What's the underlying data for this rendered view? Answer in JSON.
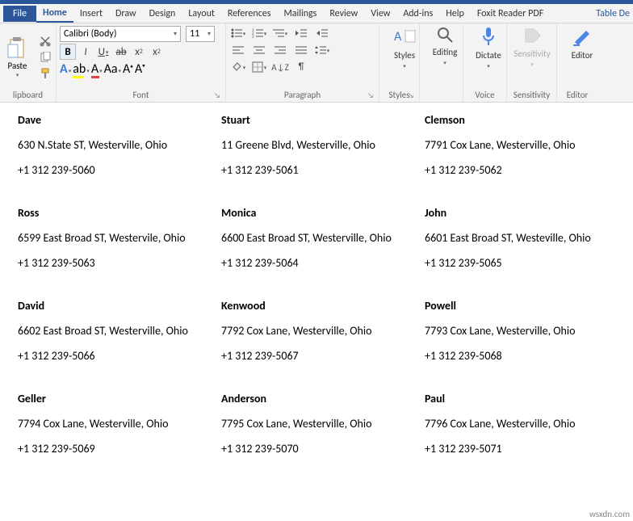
{
  "tabs": {
    "file": "File",
    "items": [
      "Home",
      "Insert",
      "Draw",
      "Design",
      "Layout",
      "References",
      "Mailings",
      "Review",
      "View",
      "Add-ins",
      "Help",
      "Foxit Reader PDF"
    ],
    "active": "Home",
    "table": "Table De"
  },
  "ribbon": {
    "clipboard": {
      "paste": "Paste",
      "label": "lipboard"
    },
    "font": {
      "name": "Calibri (Body)",
      "size": "11",
      "label": "Font"
    },
    "paragraph": {
      "label": "Paragraph"
    },
    "styles": {
      "btn": "Styles",
      "label": "Styles"
    },
    "editing": {
      "btn": "Editing"
    },
    "dictate": {
      "btn": "Dictate",
      "label": "Voice"
    },
    "sensitivity": {
      "btn": "Sensitivity",
      "label": "Sensitivity"
    },
    "editor": {
      "btn": "Editor",
      "label": "Editor"
    }
  },
  "labels": [
    {
      "name": "Dave",
      "addr": "630 N.State ST, Westerville, Ohio",
      "phone": "+1 312 239-5060"
    },
    {
      "name": "Stuart",
      "addr": "11 Greene Blvd, Westerville, Ohio",
      "phone": "+1 312 239-5061"
    },
    {
      "name": "Clemson",
      "addr": "7791 Cox Lane, Westerville, Ohio",
      "phone": "+1 312 239-5062"
    },
    {
      "name": "Ross",
      "addr": "6599 East Broad ST, Westervile, Ohio",
      "phone": "+1 312 239-5063"
    },
    {
      "name": "Monica",
      "addr": "6600 East Broad ST, Westerville, Ohio",
      "phone": "+1 312 239-5064"
    },
    {
      "name": "John",
      "addr": "6601 East Broad ST, Westeville, Ohio",
      "phone": "+1 312 239-5065"
    },
    {
      "name": "David",
      "addr": "6602 East Broad ST, Westerville, Ohio",
      "phone": "+1 312 239-5066"
    },
    {
      "name": "Kenwood",
      "addr": "7792 Cox Lane, Westerville, Ohio",
      "phone": "+1 312 239-5067"
    },
    {
      "name": "Powell",
      "addr": "7793 Cox Lane, Westerville, Ohio",
      "phone": "+1 312 239-5068"
    },
    {
      "name": "Geller",
      "addr": "7794 Cox Lane, Westerville, Ohio",
      "phone": "+1 312 239-5069"
    },
    {
      "name": "Anderson",
      "addr": "7795 Cox Lane, Westerville, Ohio",
      "phone": "+1 312 239-5070"
    },
    {
      "name": "Paul",
      "addr": "7796 Cox Lane, Westerville, Ohio",
      "phone": "+1 312 239-5071"
    }
  ],
  "watermark": "wsxdn.com"
}
